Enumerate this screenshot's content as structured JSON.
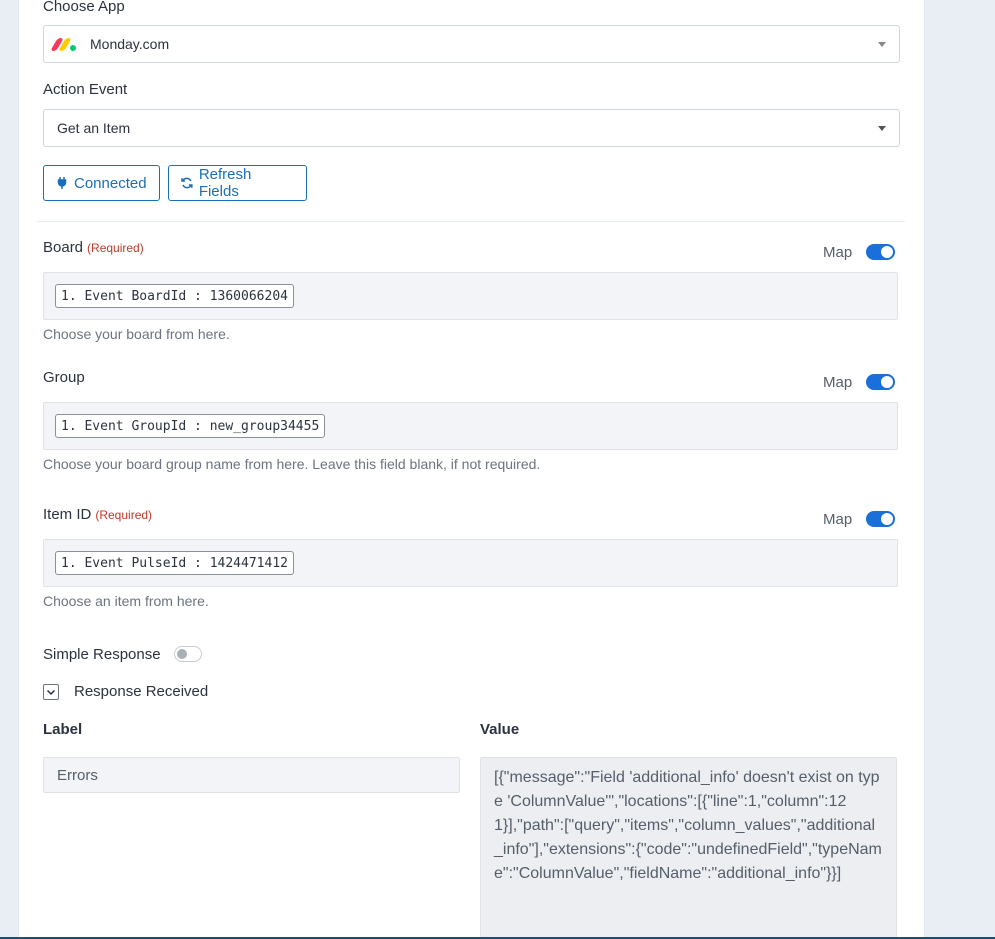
{
  "choose_app": {
    "label": "Choose App",
    "value": "Monday.com",
    "logo_icon": "monday-logo-icon"
  },
  "action_event": {
    "label": "Action Event",
    "value": "Get an Item"
  },
  "buttons": {
    "connected": "Connected",
    "refresh": "Refresh Fields"
  },
  "map_label": "Map",
  "board": {
    "label": "Board",
    "required": "(Required)",
    "chip": "1. Event BoardId : 1360066204",
    "help": "Choose your board from here.",
    "map_enabled": true
  },
  "group": {
    "label": "Group",
    "chip": "1. Event GroupId : new_group34455",
    "help": "Choose your board group name from here. Leave this field blank, if not required.",
    "map_enabled": true
  },
  "item_id": {
    "label": "Item ID",
    "required": "(Required)",
    "chip": "1. Event PulseId : 1424471412",
    "help": "Choose an item from here.",
    "map_enabled": true
  },
  "simple_response": {
    "label": "Simple Response",
    "enabled": false
  },
  "response_received": {
    "label": "Response Received",
    "expanded": true
  },
  "response_table": {
    "label_header": "Label",
    "value_header": "Value",
    "rows": [
      {
        "label": "Errors",
        "value": "[{\"message\":\"Field 'additional_info' doesn't exist on type 'ColumnValue'\",\"locations\":[{\"line\":1,\"column\":121}],\"path\":[\"query\",\"items\",\"column_values\",\"additional_info\"],\"extensions\":{\"code\":\"undefinedField\",\"typeName\":\"ColumnValue\",\"fieldName\":\"additional_info\"}}]"
      }
    ]
  },
  "colors": {
    "accent": "#1b6fd8",
    "required": "#c0392b"
  }
}
